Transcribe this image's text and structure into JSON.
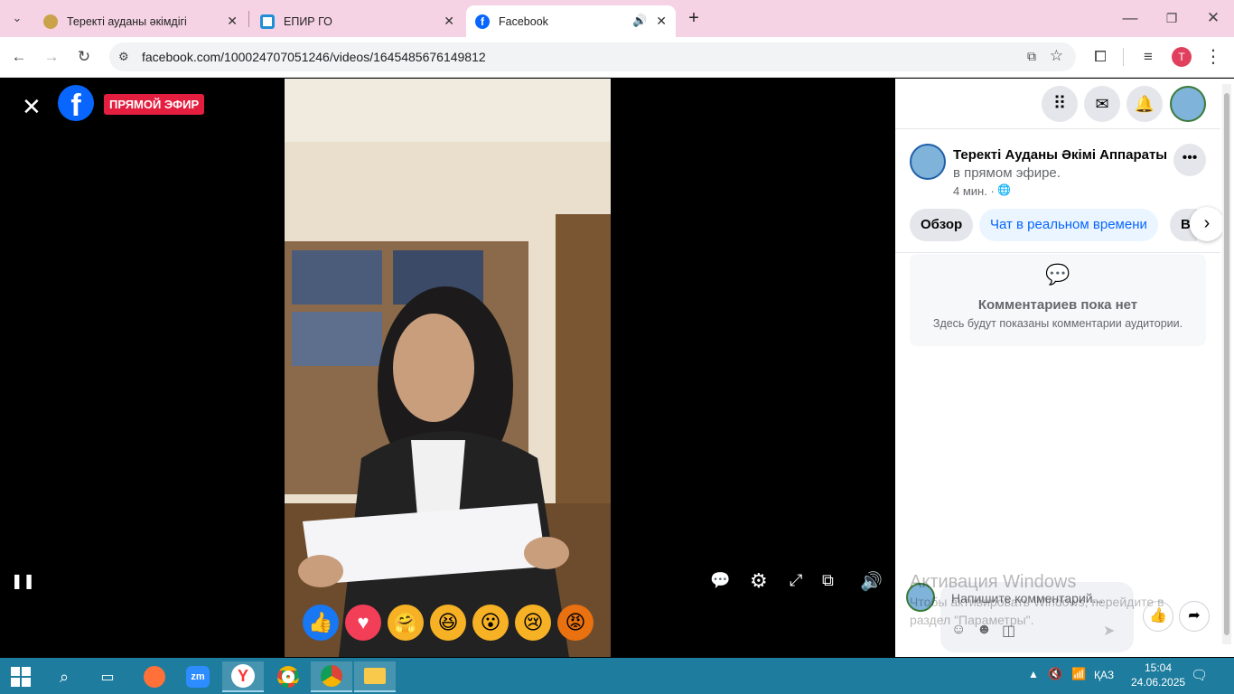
{
  "browser": {
    "tabs": [
      {
        "title": "Теректі ауданы әкімдігі"
      },
      {
        "title": "ЕПИР ГО"
      },
      {
        "title": "Facebook"
      }
    ],
    "url": "facebook.com/100024707051246/videos/1645485676149812",
    "profile_initial": "T"
  },
  "video": {
    "live_badge": "ПРЯМОЙ ЭФИР"
  },
  "post": {
    "page_name": "Теректі Ауданы Әкімі Аппараты",
    "live_suffix_1": "в",
    "live_suffix_2": "прямом эфире.",
    "time": "4 мин. ·",
    "tabs": [
      "Обзор",
      "Чат в реальном времени",
      "В"
    ]
  },
  "comments": {
    "empty_title": "Комментариев пока нет",
    "empty_subtitle": "Здесь будут показаны комментарии аудитории.",
    "input_placeholder": "Напишите комментарий..."
  },
  "watermark": {
    "line1": "Активация Windows",
    "line2": "Чтобы активировать Windows, перейдите в",
    "line3": "раздел \"Параметры\"."
  },
  "taskbar": {
    "lang": "ҚАЗ",
    "time": "15:04",
    "date": "24.06.2025"
  },
  "colors": {
    "tabstrip": "#f6d3e4",
    "fb_blue": "#0866ff",
    "live_red": "#e41e3f",
    "taskbar": "#1e7d9e"
  }
}
